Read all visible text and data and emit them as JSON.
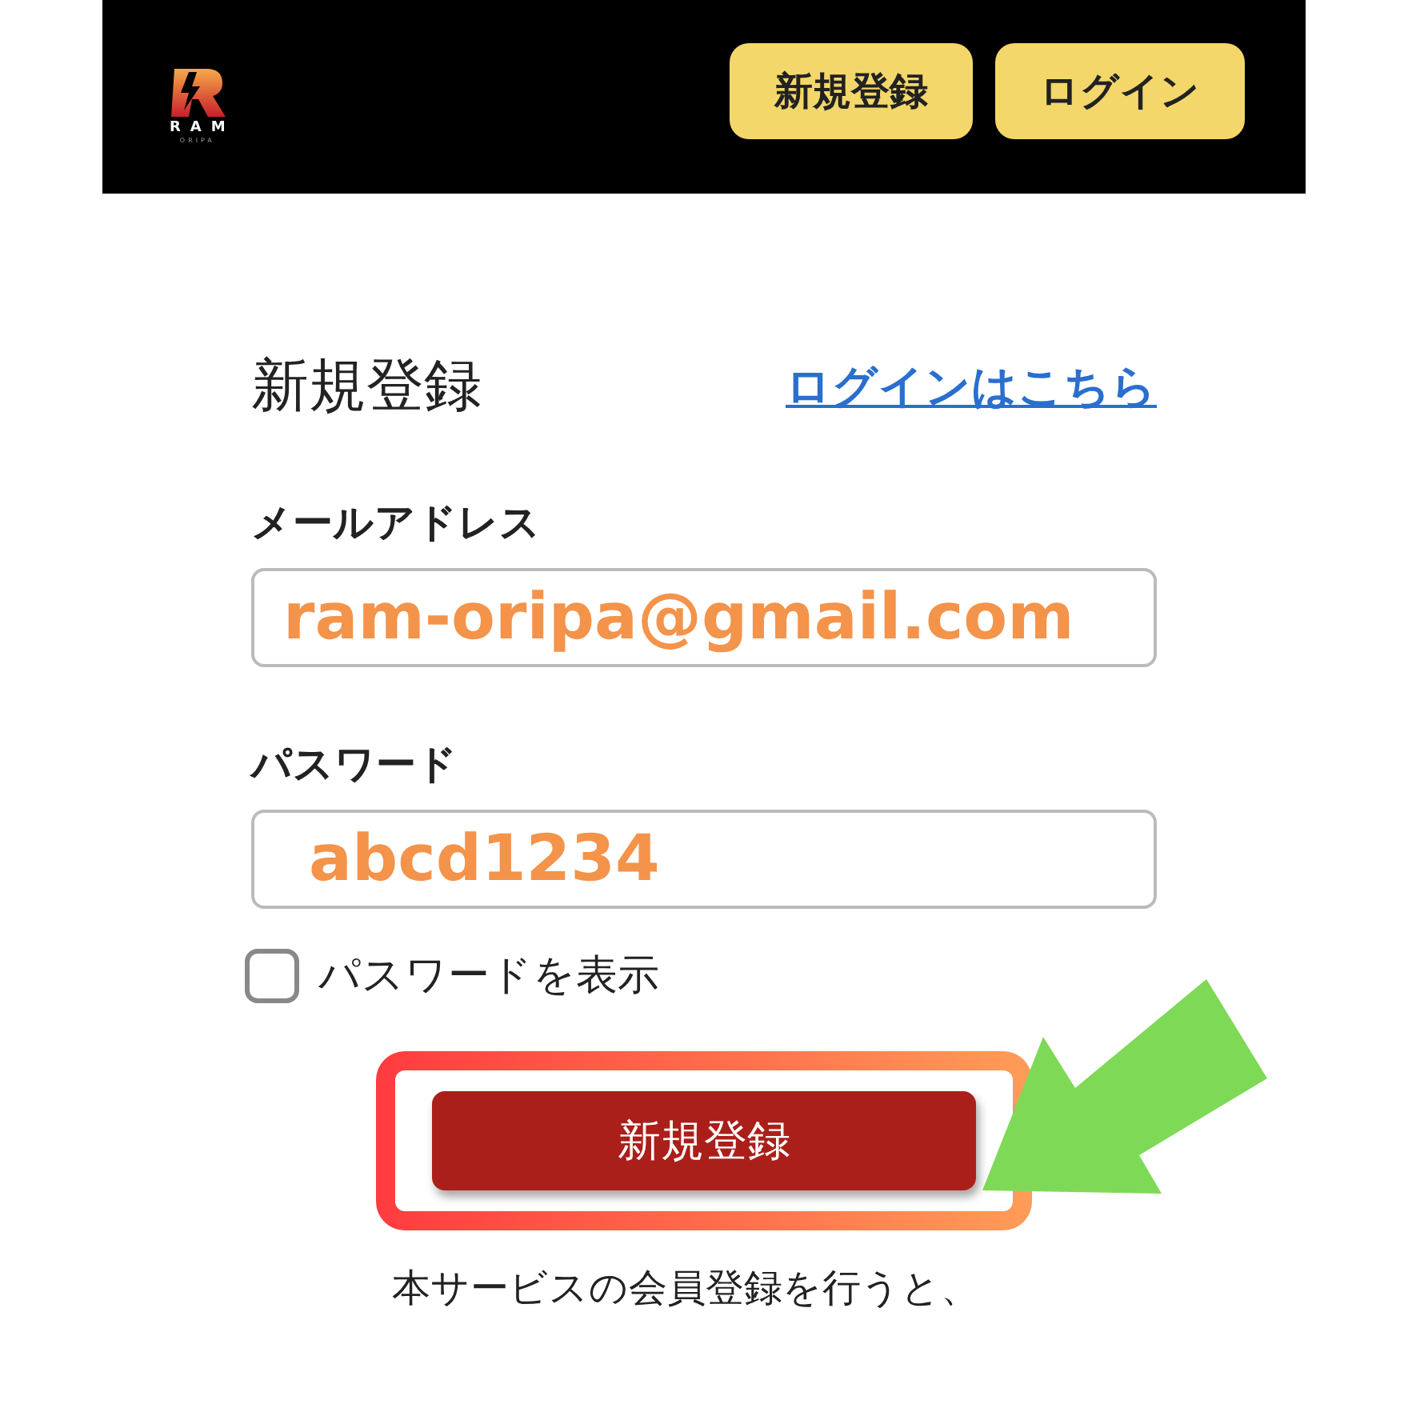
{
  "header": {
    "logo": {
      "name": "RAM",
      "sub": "ORIPA"
    },
    "buttons": [
      "新規登録",
      "ログイン"
    ]
  },
  "form": {
    "title": "新規登録",
    "login_link": "ログインはこちら",
    "fields": [
      {
        "label": "メールアドレス",
        "value": "ram-oripa@gmail.com"
      },
      {
        "label": "パスワード",
        "value": "abcd1234"
      }
    ],
    "show_password": {
      "label": "パスワードを表示",
      "checked": false
    },
    "submit": "新規登録",
    "note": "本サービスの会員登録を行うと、"
  },
  "annotations": {
    "highlight": true,
    "arrow": true
  }
}
